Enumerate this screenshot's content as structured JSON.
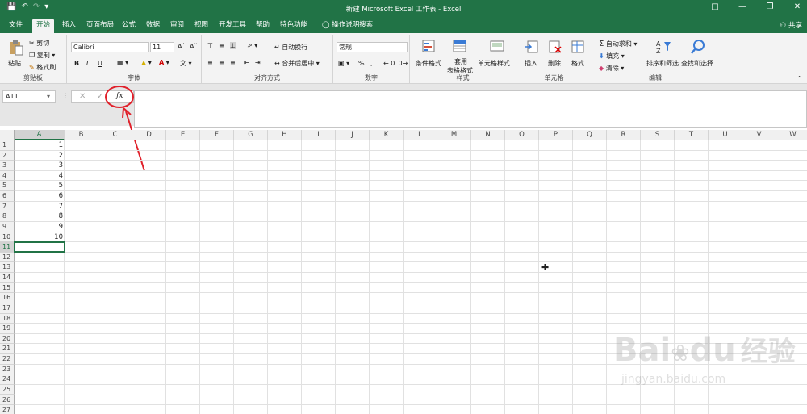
{
  "titlebar": {
    "title": "新建 Microsoft Excel 工作表 - Excel"
  },
  "tabs": [
    {
      "label": "文件"
    },
    {
      "label": "开始"
    },
    {
      "label": "插入"
    },
    {
      "label": "页面布局"
    },
    {
      "label": "公式"
    },
    {
      "label": "数据"
    },
    {
      "label": "审阅"
    },
    {
      "label": "视图"
    },
    {
      "label": "开发工具"
    },
    {
      "label": "帮助"
    },
    {
      "label": "特色功能"
    },
    {
      "label": "操作说明搜索"
    }
  ],
  "share_label": "共享",
  "ribbon": {
    "clipboard": {
      "paste": "粘贴",
      "cut": "剪切",
      "copy": "复制",
      "format_painter": "格式刷",
      "label": "剪贴板"
    },
    "font": {
      "name": "Calibri",
      "size": "11",
      "bold": "B",
      "italic": "I",
      "underline": "U",
      "label": "字体"
    },
    "alignment": {
      "wrap": "自动换行",
      "merge": "合并后居中",
      "label": "对齐方式"
    },
    "number": {
      "format": "常规",
      "percent": "%",
      "comma": ",",
      "label": "数字"
    },
    "styles": {
      "conditional": "条件格式",
      "table1": "套用",
      "table2": "表格格式",
      "cell_styles": "单元格样式",
      "label": "样式"
    },
    "cells": {
      "insert": "插入",
      "delete": "删除",
      "format": "格式",
      "label": "单元格"
    },
    "editing": {
      "autosum": "自动求和",
      "fill": "填充",
      "clear": "清除",
      "sort": "排序和筛选",
      "find": "查找和选择",
      "label": "编辑"
    }
  },
  "formula_bar": {
    "name_box": "A11",
    "fx": "fx",
    "formula": ""
  },
  "columns": [
    "A",
    "B",
    "C",
    "D",
    "E",
    "F",
    "G",
    "H",
    "I",
    "J",
    "K",
    "L",
    "M",
    "N",
    "O",
    "P",
    "Q",
    "R",
    "S",
    "T",
    "U",
    "V",
    "W"
  ],
  "rows": [
    "1",
    "2",
    "3",
    "4",
    "5",
    "6",
    "7",
    "8",
    "9",
    "10",
    "11",
    "12",
    "13",
    "14",
    "15",
    "16",
    "17",
    "18",
    "19",
    "20",
    "21",
    "22",
    "23",
    "24",
    "25",
    "26",
    "27"
  ],
  "cells_a": [
    "1",
    "2",
    "3",
    "4",
    "5",
    "6",
    "7",
    "8",
    "9",
    "10"
  ],
  "watermark": {
    "brand": "Bai",
    "brand2": "du",
    "cn": "经验",
    "url": "jingyan.baidu.com"
  },
  "colors": {
    "accent": "#217346",
    "annotation": "#e0202a"
  }
}
